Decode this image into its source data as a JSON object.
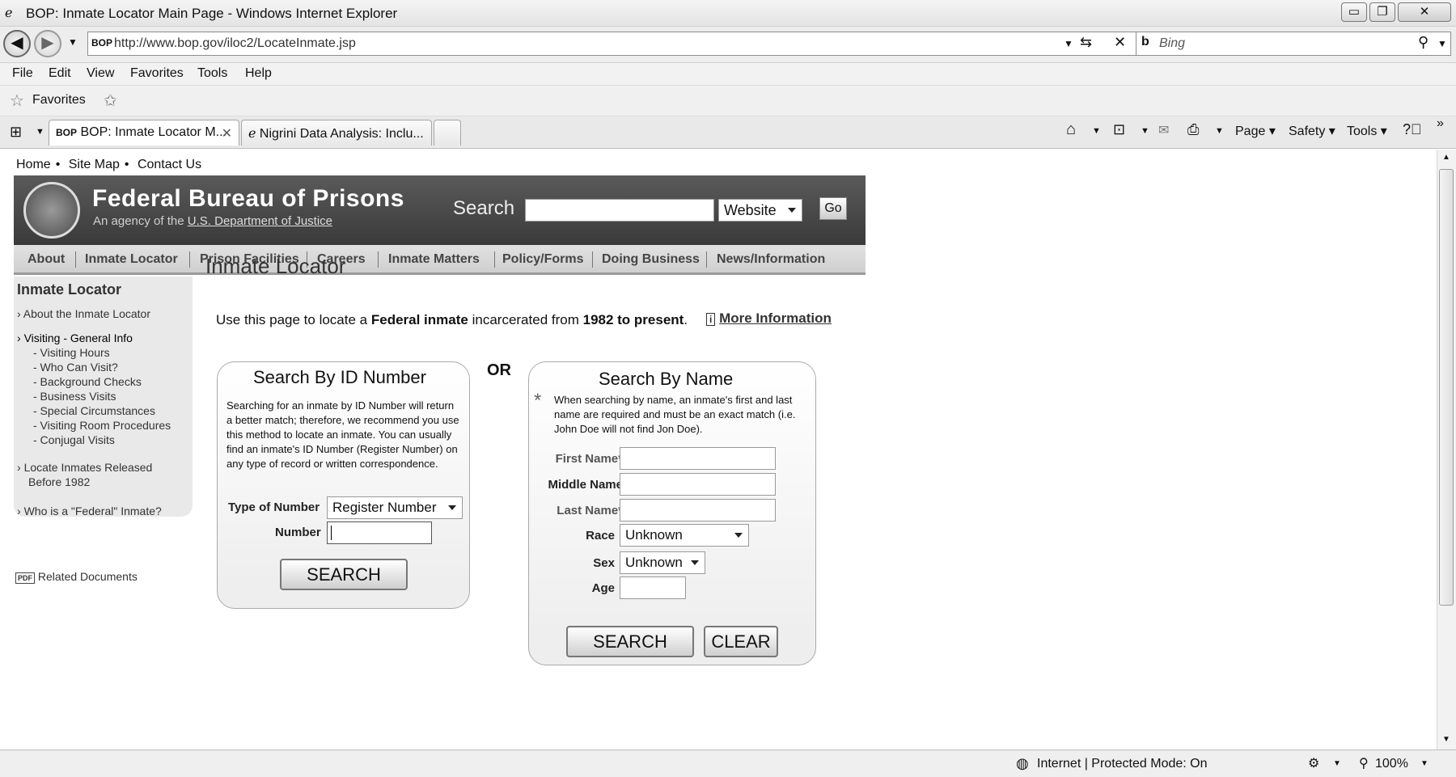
{
  "window": {
    "title": "BOP: Inmate Locator Main Page - Windows Internet Explorer",
    "minimize": "▭",
    "maximize": "❐",
    "close": "✕"
  },
  "address": {
    "favicon_text": "BOP",
    "url": "http://www.bop.gov/iloc2/LocateInmate.jsp",
    "search_engine": "Bing"
  },
  "menu": [
    "File",
    "Edit",
    "View",
    "Favorites",
    "Tools",
    "Help"
  ],
  "favorites": {
    "label": "Favorites"
  },
  "tabs": [
    {
      "label": "BOP: Inmate Locator M...",
      "icon": "BOP"
    },
    {
      "label": "Nigrini Data Analysis: Inclu..."
    }
  ],
  "commandbar": {
    "page": "Page ▾",
    "safety": "Safety ▾",
    "tools": "Tools ▾"
  },
  "site": {
    "toplinks": [
      "Home",
      "Site Map",
      "Contact Us"
    ],
    "org_name": "Federal Bureau of Prisons",
    "agency_prefix": "An agency of the",
    "agency_link": "U.S. Department of Justice",
    "search_label": "Search",
    "search_scope": "Website",
    "go_label": "Go",
    "nav": [
      "About",
      "Inmate Locator",
      "Prison Facilities",
      "Careers",
      "Inmate Matters",
      "Policy/Forms",
      "Doing Business",
      "News/Information"
    ]
  },
  "sidebar": {
    "heading": "Inmate Locator",
    "about": "About the Inmate Locator",
    "visiting": "Visiting - General Info",
    "visiting_sub": [
      "- Visiting Hours",
      "- Who Can Visit?",
      "- Background Checks",
      "- Business Visits",
      "- Special Circumstances",
      "- Visiting Room Procedures",
      "- Conjugal Visits"
    ],
    "released_line1": "Locate Inmates Released",
    "released_line2": "Before 1982",
    "federal": "Who is a \"Federal\" Inmate?",
    "related": "Related Documents",
    "pdf_icon": "PDF"
  },
  "main": {
    "title": "Inmate Locator",
    "intro_1": "Use this page to locate a",
    "intro_bold_1": "Federal inmate",
    "intro_2": "incarcerated from",
    "intro_bold_2": "1982 to present",
    "intro_3": ".",
    "more_info": "More Information",
    "or": "OR"
  },
  "id_search": {
    "heading": "Search By ID Number",
    "description": "Searching for an inmate by ID Number will return a better match; therefore, we recommend you use this method to locate an inmate. You can usually find an inmate's ID Number (Register Number) on any type of record or written correspondence.",
    "type_label": "Type of Number",
    "type_value": "Register Number",
    "number_label": "Number",
    "search_button": "SEARCH"
  },
  "name_search": {
    "heading": "Search By Name",
    "asterisk": "*",
    "note": "When searching by name, an inmate's first and last name are required and must be an exact match (i.e. John Doe will not find Jon Doe).",
    "first_label": "First Name*",
    "middle_label": "Middle Name",
    "last_label": "Last Name*",
    "race_label": "Race",
    "race_value": "Unknown",
    "sex_label": "Sex",
    "sex_value": "Unknown",
    "age_label": "Age",
    "search_button": "SEARCH",
    "clear_button": "CLEAR"
  },
  "status": {
    "zone": "Internet | Protected Mode: On",
    "zoom": "100%"
  }
}
